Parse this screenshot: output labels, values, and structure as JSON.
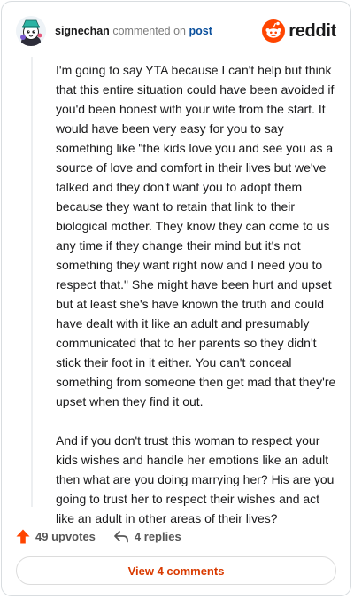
{
  "header": {
    "username": "signechan",
    "action_text": "commented on",
    "target_link": "post",
    "brand_name": "reddit",
    "brand_color": "#ff4500"
  },
  "comment": {
    "paragraphs": [
      "I'm going to say YTA because I can't help but think that this entire situation could have been avoided if you'd been honest with your wife from the start. It would have been very easy for you to say something like \"the kids love you and see you as a source of love and comfort in their lives but we've talked and they don't want you to adopt them because they want to retain that link to their biological mother. They know they can come to us any time if they change their mind but it's not something they want right now and I need you to respect that.\" She might have been hurt and upset but at least she's have known the truth and could have dealt with it like an adult and presumably communicated that to her parents so they didn't stick their foot in it either. You can't conceal something from someone then get mad that they're upset when they find it out.",
      "And if you don't trust this woman to respect your kids wishes and handle her emotions like an adult then what are you doing marrying her? His are you going to trust her to respect their wishes and act like an adult in other areas of their lives?"
    ]
  },
  "footer": {
    "upvotes_label": "49 upvotes",
    "replies_label": "4 replies",
    "upvote_icon": "upvote-arrow-icon",
    "reply_icon": "reply-arrow-icon",
    "upvote_color": "#ff4500"
  },
  "view_comments_label": "View 4 comments"
}
